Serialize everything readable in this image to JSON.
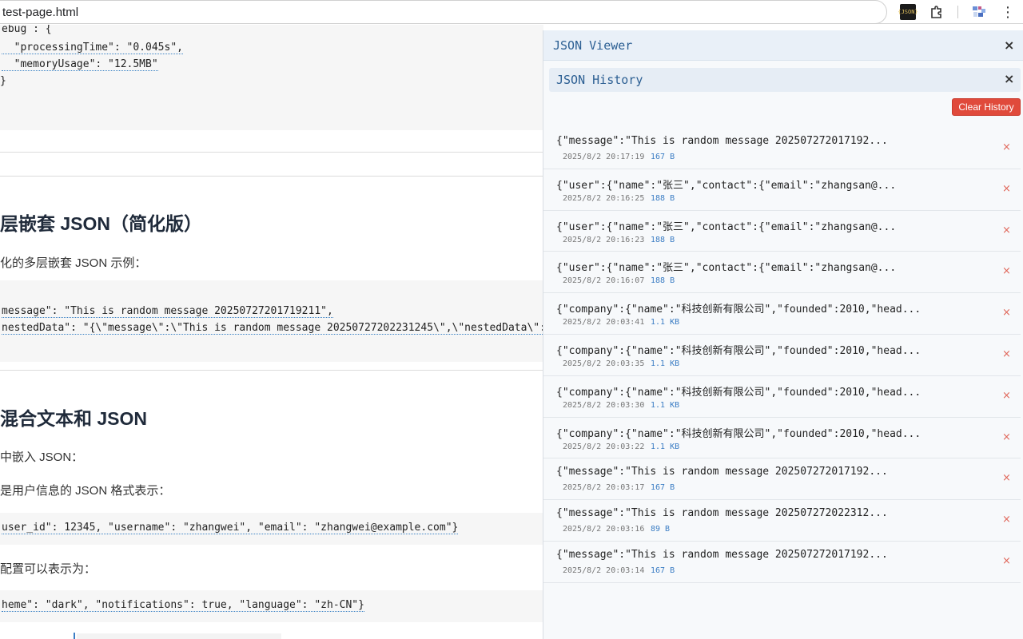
{
  "browser": {
    "address": "test-page.html"
  },
  "page": {
    "code1_lines": [
      "ebug : {",
      "  \"processingTime\": \"0.045s\",",
      "  \"memoryUsage\": \"12.5MB\"",
      "}"
    ],
    "heading1": "层嵌套 JSON（简化版）",
    "para1": "化的多层嵌套 JSON 示例：",
    "code2_lines": [
      "message\": \"This is random message 20250727201719211\",",
      "nestedData\": \"{\\\"message\\\":\\\"This is random message 20250727202231245\\\",\\\"nestedData\\\":"
    ],
    "heading2": "混合文本和 JSON",
    "para2": "中嵌入 JSON：",
    "para3": "是用户信息的 JSON 格式表示：",
    "code3": "user_id\": 12345, \"username\": \"zhangwei\", \"email\": \"zhangwei@example.com\"}",
    "para4": "配置可以表示为：",
    "code4": "heme\": \"dark\", \"notifications\": true, \"language\": \"zh-CN\"}"
  },
  "viewer": {
    "title": "JSON Viewer",
    "history_title": "JSON History",
    "clear_label": "Clear History",
    "close_glyph": "×",
    "items": [
      {
        "preview": "{\"message\":\"This is random message 202507272017192...",
        "time": "2025/8/2 20:17:19",
        "size": "167 B"
      },
      {
        "preview": "{\"user\":{\"name\":\"张三\",\"contact\":{\"email\":\"zhangsan@...",
        "time": "2025/8/2 20:16:25",
        "size": "188 B"
      },
      {
        "preview": "{\"user\":{\"name\":\"张三\",\"contact\":{\"email\":\"zhangsan@...",
        "time": "2025/8/2 20:16:23",
        "size": "188 B"
      },
      {
        "preview": "{\"user\":{\"name\":\"张三\",\"contact\":{\"email\":\"zhangsan@...",
        "time": "2025/8/2 20:16:07",
        "size": "188 B"
      },
      {
        "preview": "{\"company\":{\"name\":\"科技创新有限公司\",\"founded\":2010,\"head...",
        "time": "2025/8/2 20:03:41",
        "size": "1.1 KB"
      },
      {
        "preview": "{\"company\":{\"name\":\"科技创新有限公司\",\"founded\":2010,\"head...",
        "time": "2025/8/2 20:03:35",
        "size": "1.1 KB"
      },
      {
        "preview": "{\"company\":{\"name\":\"科技创新有限公司\",\"founded\":2010,\"head...",
        "time": "2025/8/2 20:03:30",
        "size": "1.1 KB"
      },
      {
        "preview": "{\"company\":{\"name\":\"科技创新有限公司\",\"founded\":2010,\"head...",
        "time": "2025/8/2 20:03:22",
        "size": "1.1 KB"
      },
      {
        "preview": "{\"message\":\"This is random message 202507272017192...",
        "time": "2025/8/2 20:03:17",
        "size": "167 B"
      },
      {
        "preview": "{\"message\":\"This is random message 202507272022312...",
        "time": "2025/8/2 20:03:16",
        "size": "89 B"
      },
      {
        "preview": "{\"message\":\"This is random message 202507272017192...",
        "time": "2025/8/2 20:03:14",
        "size": "167 B"
      }
    ]
  }
}
